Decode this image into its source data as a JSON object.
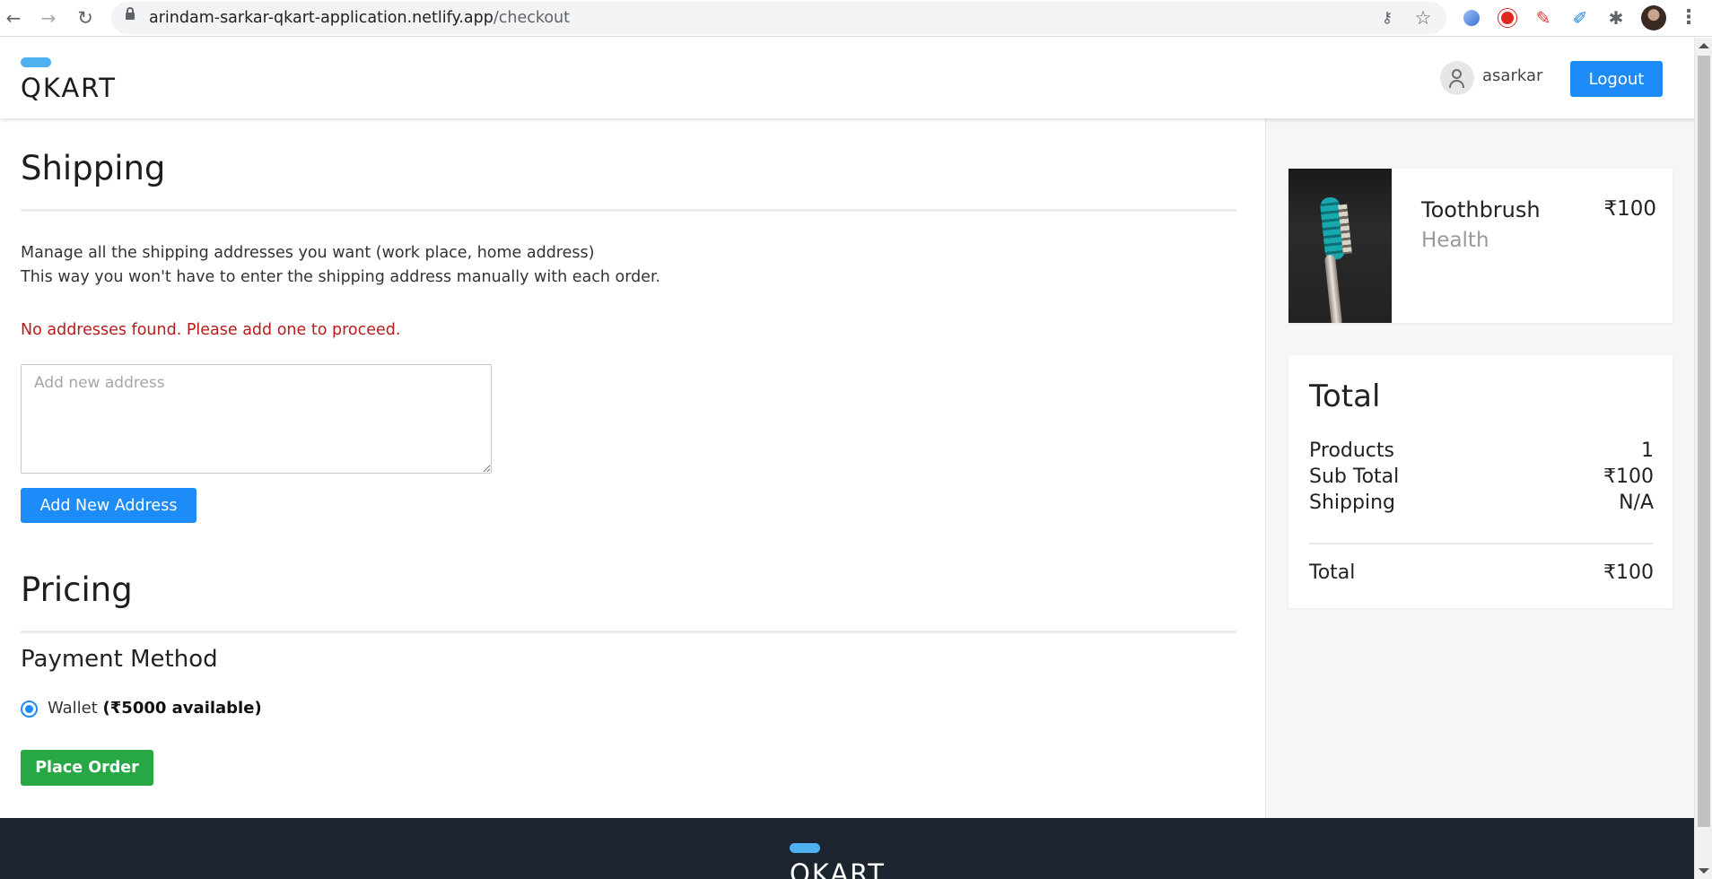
{
  "browser": {
    "url_host": "arindam-sarkar-qkart-application.netlify.app",
    "url_path": "/checkout",
    "icons": [
      "back-arrow-icon",
      "forward-arrow-icon",
      "reload-icon",
      "lock-icon",
      "key-icon",
      "star-icon",
      "extension-icon",
      "puzzle-icon",
      "profile-avatar",
      "menu-dots-icon"
    ],
    "back_glyph": "←",
    "forward_glyph": "→",
    "reload_glyph": "↻",
    "key_glyph": "⚷",
    "star_glyph": "☆",
    "pen_glyph": "✎",
    "marker_glyph": "✐",
    "puzzle_glyph": "✱",
    "menu_glyph": "⋮"
  },
  "header": {
    "logo": "QKART",
    "username": "asarkar",
    "logout_label": "Logout"
  },
  "shipping": {
    "title": "Shipping",
    "desc_line1": "Manage all the shipping addresses you want (work place, home address)",
    "desc_line2": "This way you won't have to enter the shipping address manually with each order.",
    "error": "No addresses found. Please add one to proceed.",
    "address_placeholder": "Add new address",
    "add_button": "Add New Address"
  },
  "pricing": {
    "title": "Pricing",
    "payment_method_title": "Payment Method",
    "wallet_label": "Wallet",
    "wallet_available": "(₹5000 available)",
    "place_order": "Place Order"
  },
  "cart": {
    "items": [
      {
        "name": "Toothbrush",
        "category": "Health",
        "price": "₹100"
      }
    ]
  },
  "totals": {
    "title": "Total",
    "products_label": "Products",
    "products_value": "1",
    "subtotal_label": "Sub Total",
    "subtotal_value": "₹100",
    "shipping_label": "Shipping",
    "shipping_value": "N/A",
    "total_label": "Total",
    "total_value": "₹100"
  },
  "footer": {
    "logo": "QKART"
  },
  "colors": {
    "primary": "#1d8cf8",
    "success": "#28a745",
    "error": "#b71c1c",
    "footer_bg": "#1c2430"
  }
}
